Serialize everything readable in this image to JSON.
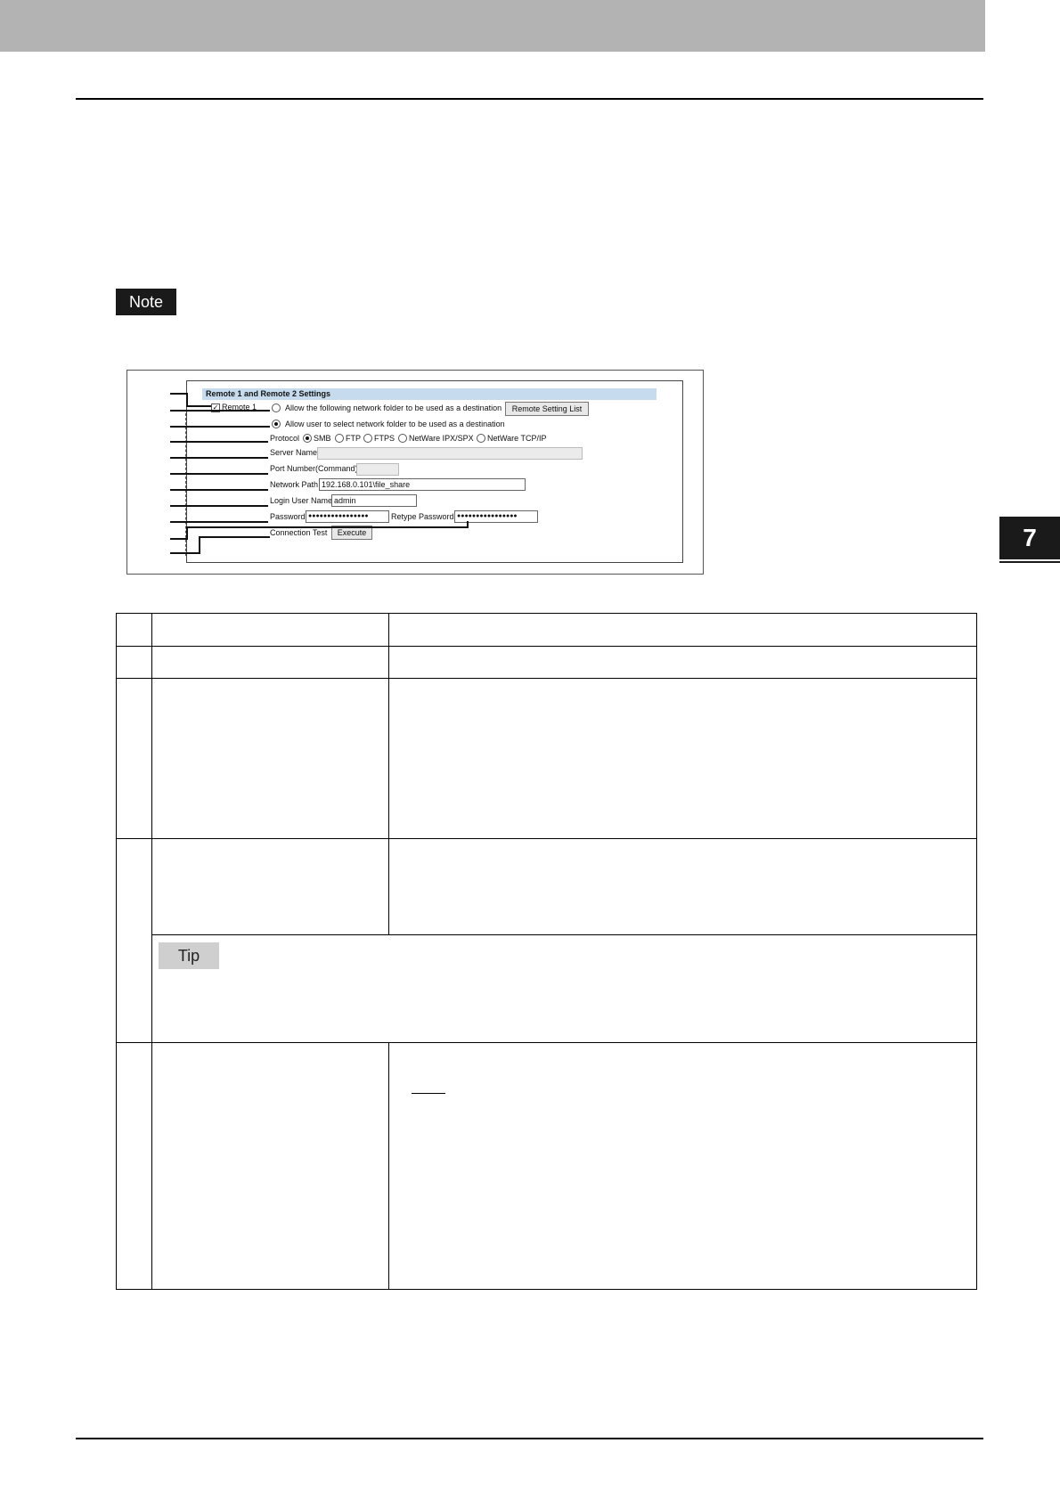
{
  "page": {
    "note_label": "Note",
    "chapter_number": "7",
    "tip_label": "Tip"
  },
  "figure": {
    "panel_title": "Remote 1 and Remote 2 Settings",
    "remote_checkbox_label": "Remote 1",
    "remote_checked_mark": "✓",
    "option_fixed_folder": "Allow the following network folder to be used as a destination",
    "remote_setting_list_button": "Remote Setting List",
    "option_user_select": "Allow user to select network folder to be used as a destination",
    "protocol_label": "Protocol",
    "protocols": [
      "SMB",
      "FTP",
      "FTPS",
      "NetWare IPX/SPX",
      "NetWare TCP/IP"
    ],
    "protocol_selected": "SMB",
    "server_name_label": "Server Name",
    "server_name_value": "",
    "port_number_label": "Port Number(Command)",
    "port_number_value": "",
    "network_path_label": "Network Path",
    "network_path_value": "192.168.0.101\\file_share",
    "login_user_label": "Login User Name",
    "login_user_value": "admin",
    "password_label": "Password",
    "password_value": "●●●●●●●●●●●●●●●●",
    "retype_password_label": "Retype Password",
    "retype_password_value": "●●●●●●●●●●●●●●●●",
    "connection_test_label": "Connection Test",
    "execute_button": "Execute"
  }
}
